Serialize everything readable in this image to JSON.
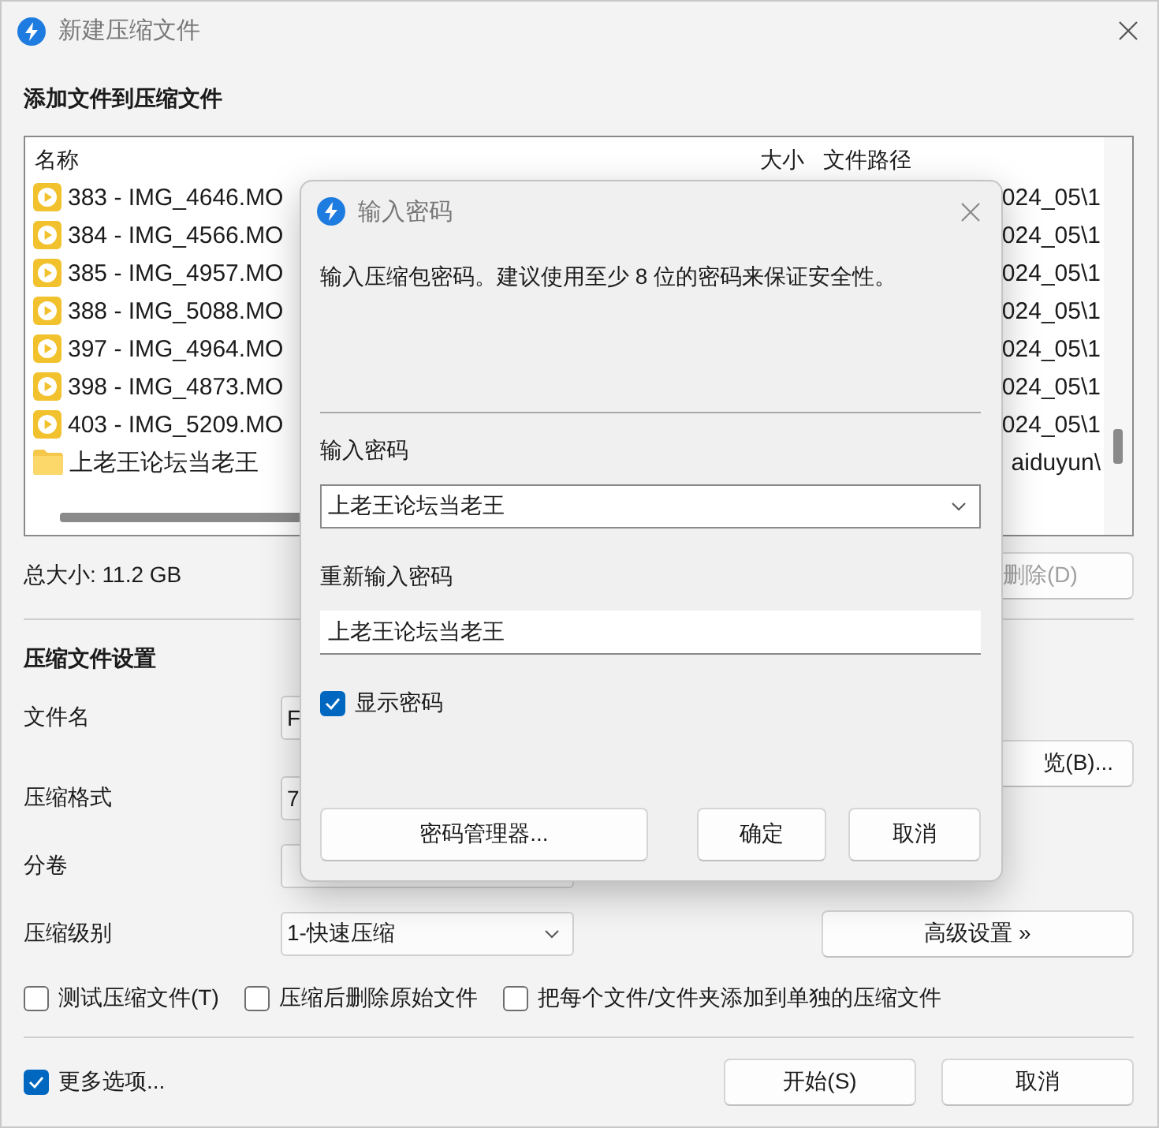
{
  "window": {
    "title": "新建压缩文件"
  },
  "files": {
    "heading": "添加文件到压缩文件",
    "columns": [
      "名称",
      "大小",
      "文件路径"
    ],
    "rows": [
      {
        "kind": "video",
        "name": "383 - IMG_4646.MO",
        "path": "024_05\\1"
      },
      {
        "kind": "video",
        "name": "384 - IMG_4566.MO",
        "path": "024_05\\1"
      },
      {
        "kind": "video",
        "name": "385 - IMG_4957.MO",
        "path": "024_05\\1"
      },
      {
        "kind": "video",
        "name": "388 - IMG_5088.MO",
        "path": "024_05\\1"
      },
      {
        "kind": "video",
        "name": "397 - IMG_4964.MO",
        "path": "024_05\\1"
      },
      {
        "kind": "video",
        "name": "398 - IMG_4873.MO",
        "path": "024_05\\1"
      },
      {
        "kind": "video",
        "name": "403 - IMG_5209.MO",
        "path": "024_05\\1"
      },
      {
        "kind": "folder",
        "name": "上老王论坛当老王",
        "path": "aiduyun\\"
      }
    ],
    "total_size": "总大小: 11.2 GB",
    "delete_button": "删除(D)"
  },
  "settings": {
    "heading": "压缩文件设置",
    "rows": [
      {
        "kind": "field",
        "label": "文件名",
        "value": "F",
        "button": "览(B)..."
      },
      {
        "kind": "box",
        "label": "压缩格式",
        "value": "7"
      },
      {
        "kind": "box",
        "label": "分卷"
      },
      {
        "kind": "combo",
        "label": "压缩级别",
        "value": "1-快速压缩",
        "button": "高级设置 »"
      }
    ],
    "options": [
      {
        "label": "测试压缩文件(T)",
        "checked": false
      },
      {
        "label": "压缩后删除原始文件",
        "checked": false
      },
      {
        "label": "把每个文件/文件夹添加到单独的压缩文件",
        "checked": false
      }
    ]
  },
  "more_options": {
    "label": "更多选项...",
    "checked": true
  },
  "buttons": [
    "开始(S)",
    "取消"
  ],
  "dialog": {
    "title": "输入密码",
    "description": "输入压缩包密码。建议使用至少 8 位的密码来保证安全性。",
    "password_label": "输入密码",
    "password": "上老王论坛当老王",
    "confirm_label": "重新输入密码",
    "confirm": "上老王论坛当老王",
    "show_password": {
      "label": "显示密码",
      "checked": true
    },
    "buttons": [
      "密码管理器...",
      "确定",
      "取消"
    ]
  }
}
